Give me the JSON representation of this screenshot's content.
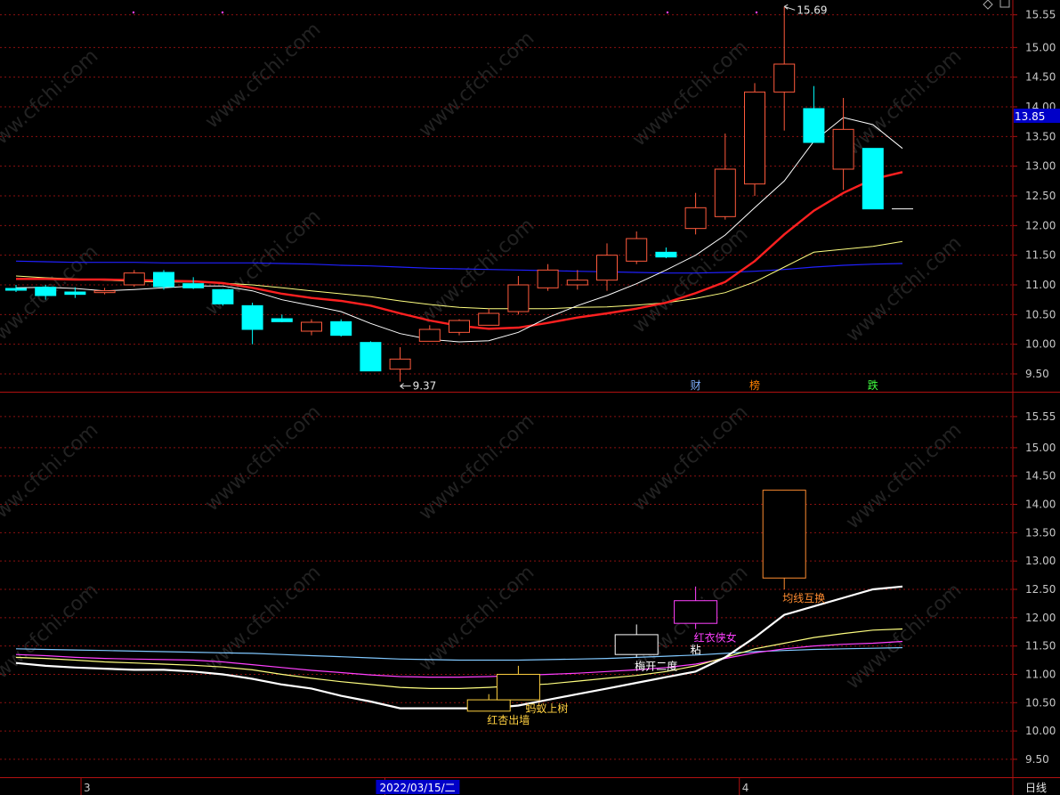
{
  "colors": {
    "background": "#000000",
    "up": "#ff5a3c",
    "down": "#00ffff",
    "ma5": "#ffffff",
    "ma10": "#ffff80",
    "ma20": "#ff2020",
    "ma60": "#2020ff",
    "frame": "#b01010",
    "axis_text": "#c8c8c8",
    "grid": "#8a1010"
  },
  "watermark": "www.cfchi.com",
  "chart_data": [
    {
      "type": "candlestick",
      "panel": "main",
      "y_ticks": [
        "15.55",
        "15.00",
        "14.50",
        "14.00",
        "13.50",
        "13.00",
        "12.50",
        "12.00",
        "11.50",
        "11.00",
        "10.50",
        "10.00",
        "9.50"
      ],
      "ylim": [
        9.2,
        15.8
      ],
      "current_price": "13.85",
      "high_annotation": "15.69",
      "low_annotation": "9.37",
      "candles": [
        {
          "o": 10.94,
          "h": 11.0,
          "l": 10.88,
          "c": 10.91
        },
        {
          "o": 10.96,
          "h": 11.0,
          "l": 10.75,
          "c": 10.82
        },
        {
          "o": 10.88,
          "h": 10.96,
          "l": 10.78,
          "c": 10.84
        },
        {
          "o": 10.87,
          "h": 10.95,
          "l": 10.84,
          "c": 10.9
        },
        {
          "o": 11.0,
          "h": 11.25,
          "l": 10.97,
          "c": 11.2
        },
        {
          "o": 11.21,
          "h": 11.25,
          "l": 10.92,
          "c": 10.97
        },
        {
          "o": 11.02,
          "h": 11.13,
          "l": 10.93,
          "c": 10.95
        },
        {
          "o": 10.92,
          "h": 10.93,
          "l": 10.65,
          "c": 10.68
        },
        {
          "o": 10.65,
          "h": 10.7,
          "l": 10.0,
          "c": 10.25
        },
        {
          "o": 10.43,
          "h": 10.5,
          "l": 10.37,
          "c": 10.38
        },
        {
          "o": 10.22,
          "h": 10.42,
          "l": 10.15,
          "c": 10.37
        },
        {
          "o": 10.38,
          "h": 10.42,
          "l": 10.13,
          "c": 10.15
        },
        {
          "o": 10.03,
          "h": 10.05,
          "l": 9.55,
          "c": 9.55
        },
        {
          "o": 9.58,
          "h": 9.95,
          "l": 9.37,
          "c": 9.75
        },
        {
          "o": 10.05,
          "h": 10.32,
          "l": 10.05,
          "c": 10.25
        },
        {
          "o": 10.2,
          "h": 10.42,
          "l": 10.15,
          "c": 10.4
        },
        {
          "o": 10.32,
          "h": 10.6,
          "l": 10.32,
          "c": 10.52
        },
        {
          "o": 10.55,
          "h": 11.15,
          "l": 10.5,
          "c": 11.0
        },
        {
          "o": 10.95,
          "h": 11.35,
          "l": 10.9,
          "c": 11.25
        },
        {
          "o": 11.0,
          "h": 11.25,
          "l": 10.92,
          "c": 11.08
        },
        {
          "o": 11.08,
          "h": 11.7,
          "l": 10.9,
          "c": 11.5
        },
        {
          "o": 11.4,
          "h": 11.9,
          "l": 11.35,
          "c": 11.78
        },
        {
          "o": 11.55,
          "h": 11.63,
          "l": 11.45,
          "c": 11.47
        },
        {
          "o": 11.95,
          "h": 12.55,
          "l": 11.85,
          "c": 12.3
        },
        {
          "o": 12.15,
          "h": 13.55,
          "l": 12.1,
          "c": 12.95
        },
        {
          "o": 12.7,
          "h": 14.4,
          "l": 12.5,
          "c": 14.25
        },
        {
          "o": 14.25,
          "h": 15.69,
          "l": 13.6,
          "c": 14.72
        },
        {
          "o": 13.97,
          "h": 14.35,
          "l": 13.4,
          "c": 13.4
        },
        {
          "o": 12.95,
          "h": 14.15,
          "l": 12.6,
          "c": 13.62
        },
        {
          "o": 13.3,
          "h": 13.3,
          "l": 12.28,
          "c": 12.28
        },
        {
          "o": 12.28,
          "h": 12.28,
          "l": 12.28,
          "c": 12.28
        }
      ],
      "ma5": [
        10.95,
        10.96,
        10.94,
        10.9,
        10.92,
        10.95,
        10.98,
        10.98,
        10.9,
        10.75,
        10.65,
        10.55,
        10.35,
        10.18,
        10.08,
        10.04,
        10.06,
        10.2,
        10.45,
        10.65,
        10.82,
        11.02,
        11.25,
        11.5,
        11.84,
        12.3,
        12.75,
        13.42,
        13.82,
        13.7,
        13.3
      ],
      "ma10": [
        11.15,
        11.12,
        11.1,
        11.08,
        11.06,
        11.05,
        11.05,
        11.03,
        11.0,
        10.95,
        10.9,
        10.85,
        10.8,
        10.73,
        10.67,
        10.62,
        10.6,
        10.6,
        10.6,
        10.62,
        10.63,
        10.66,
        10.7,
        10.77,
        10.87,
        11.05,
        11.3,
        11.55,
        11.6,
        11.65,
        11.73
      ],
      "ma20": [
        11.1,
        11.1,
        11.09,
        11.09,
        11.08,
        11.07,
        11.06,
        11.03,
        10.95,
        10.85,
        10.78,
        10.73,
        10.65,
        10.52,
        10.4,
        10.31,
        10.26,
        10.28,
        10.36,
        10.45,
        10.52,
        10.6,
        10.7,
        10.86,
        11.05,
        11.4,
        11.85,
        12.25,
        12.55,
        12.78,
        12.9
      ],
      "ma60": [
        11.4,
        11.39,
        11.38,
        11.38,
        11.38,
        11.37,
        11.37,
        11.37,
        11.37,
        11.36,
        11.35,
        11.33,
        11.32,
        11.3,
        11.28,
        11.27,
        11.26,
        11.25,
        11.24,
        11.23,
        11.22,
        11.21,
        11.2,
        11.2,
        11.21,
        11.23,
        11.26,
        11.3,
        11.33,
        11.35,
        11.36
      ],
      "event_markers": [
        {
          "label": "财",
          "color": "#80b0ff",
          "index": 23
        },
        {
          "label": "榜",
          "color": "#ff8000",
          "index": 25
        },
        {
          "label": "跌",
          "color": "#40ff40",
          "index": 29
        }
      ]
    },
    {
      "type": "pattern-indicator",
      "panel": "sub",
      "y_ticks": [
        "15.55",
        "15.00",
        "14.50",
        "14.00",
        "13.50",
        "13.00",
        "12.50",
        "12.00",
        "11.50",
        "11.00",
        "10.50",
        "10.00",
        "9.50"
      ],
      "ylim": [
        9.2,
        15.8
      ],
      "ma_white": [
        11.2,
        11.15,
        11.12,
        11.1,
        11.08,
        11.08,
        11.05,
        11.0,
        10.92,
        10.82,
        10.75,
        10.62,
        10.52,
        10.4,
        10.4,
        10.4,
        10.4,
        10.45,
        10.55,
        10.65,
        10.75,
        10.85,
        10.95,
        11.05,
        11.3,
        11.65,
        12.05,
        12.2,
        12.35,
        12.5,
        12.55
      ],
      "ma_yellow": [
        11.3,
        11.28,
        11.25,
        11.22,
        11.2,
        11.18,
        11.16,
        11.13,
        11.08,
        11.0,
        10.93,
        10.87,
        10.82,
        10.77,
        10.75,
        10.75,
        10.77,
        10.8,
        10.83,
        10.88,
        10.93,
        10.98,
        11.05,
        11.15,
        11.3,
        11.45,
        11.55,
        11.65,
        11.72,
        11.78,
        11.8
      ],
      "ma_magenta": [
        11.35,
        11.33,
        11.3,
        11.28,
        11.27,
        11.26,
        11.25,
        11.22,
        11.17,
        11.12,
        11.07,
        11.03,
        10.99,
        10.96,
        10.95,
        10.95,
        10.96,
        10.98,
        11.0,
        11.02,
        11.05,
        11.08,
        11.12,
        11.18,
        11.28,
        11.38,
        11.45,
        11.5,
        11.53,
        11.55,
        11.58
      ],
      "ma_blue": [
        11.45,
        11.44,
        11.43,
        11.42,
        11.41,
        11.4,
        11.39,
        11.38,
        11.37,
        11.35,
        11.33,
        11.31,
        11.29,
        11.27,
        11.26,
        11.25,
        11.25,
        11.25,
        11.26,
        11.27,
        11.28,
        11.3,
        11.32,
        11.34,
        11.37,
        11.4,
        11.42,
        11.44,
        11.45,
        11.46,
        11.47
      ],
      "patterns": [
        {
          "label": "红杏出墙",
          "color": "#ffd040",
          "index": 16,
          "o": 10.35,
          "c": 10.55,
          "h": 10.65,
          "l": 10.35,
          "textLift": -0.02
        },
        {
          "label": "蚂蚁上树",
          "color": "#ffd040",
          "index": 17,
          "o": 10.55,
          "c": 11.0,
          "h": 11.15,
          "l": 10.55,
          "textLift": 0.05
        },
        {
          "label": "梅开二度",
          "color": "#ffffff",
          "index": 21,
          "o": 11.35,
          "c": 11.7,
          "h": 11.88,
          "l": 11.3,
          "textLift": 0.0
        },
        {
          "label": "红衣侠女",
          "color": "#ff40ff",
          "index": 23,
          "o": 11.9,
          "c": 12.3,
          "h": 12.55,
          "l": 11.8,
          "textLift": 0.0
        },
        {
          "label": "均线互换",
          "color": "#ff8c30",
          "index": 26,
          "o": 12.7,
          "c": 14.25,
          "h": 14.25,
          "l": 12.5,
          "textLift": 0.0
        }
      ],
      "extra_labels": [
        {
          "label": "粘",
          "color": "#ffffff",
          "index": 23,
          "y": 11.43
        }
      ]
    }
  ],
  "x_axis": {
    "labels": [
      {
        "text": "3",
        "pos": 0.08
      },
      {
        "text": "2022/03/15/二",
        "highlight": true,
        "pos": 0.38
      },
      {
        "text": "4",
        "pos": 0.73
      }
    ],
    "period": "日线"
  }
}
